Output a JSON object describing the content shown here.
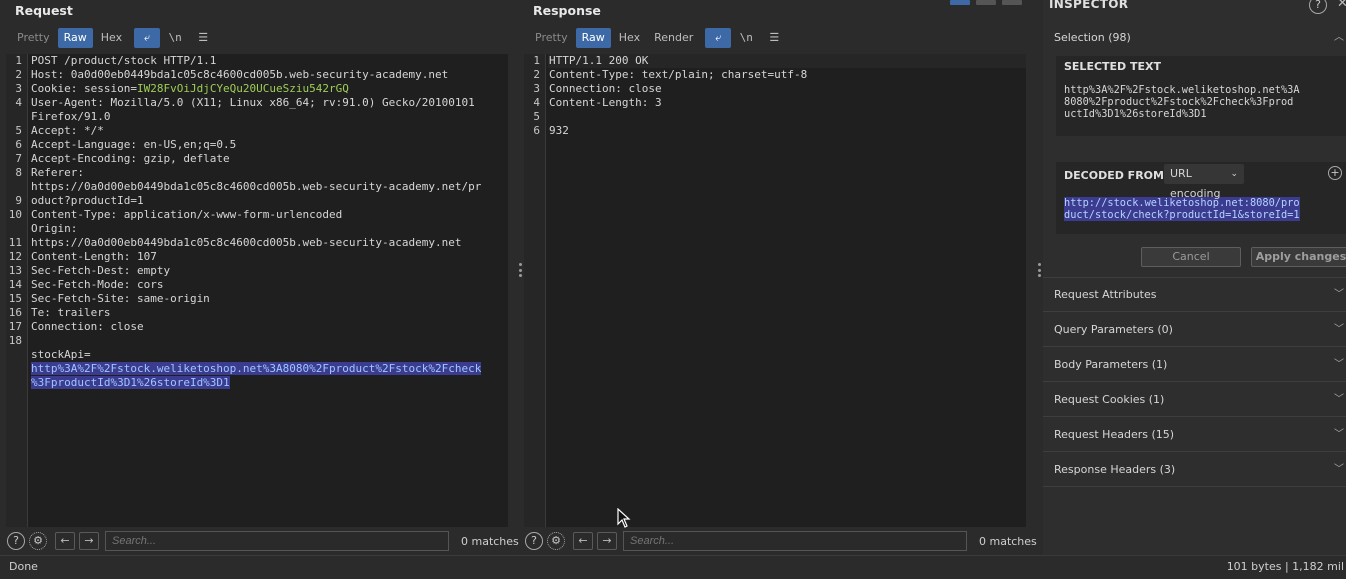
{
  "request": {
    "title": "Request",
    "tabs": [
      "Pretty",
      "Raw",
      "Hex"
    ],
    "active_tab": "Raw",
    "line_numbers": [
      "1",
      "2",
      "3",
      "4",
      "",
      "5",
      "6",
      "7",
      "8",
      "",
      "9",
      "10",
      "",
      "11",
      "12",
      "13",
      "14",
      "15",
      "16",
      "17",
      "18",
      "",
      ""
    ],
    "lines": {
      "l1": "POST /product/stock HTTP/1.1",
      "l2": "Host: 0a0d00eb0449bda1c05c8c4600cd005b.web-security-academy.net",
      "l3_key": "Cookie: session=",
      "l3_val": "IW28FvOiJdjCYeQu20UCueSziu542rGQ",
      "l4a": "User-Agent: Mozilla/5.0 (X11; Linux x86_64; rv:91.0) Gecko/20100101",
      "l4b": "Firefox/91.0",
      "l5": "Accept: */*",
      "l6": "Accept-Language: en-US,en;q=0.5",
      "l7": "Accept-Encoding: gzip, deflate",
      "l8a": "Referer:",
      "l8b": "https://0a0d00eb0449bda1c05c8c4600cd005b.web-security-academy.net/pr",
      "l8c": "oduct?productId=1",
      "l9": "Content-Type: application/x-www-form-urlencoded",
      "l10a": "Origin:",
      "l10b": "https://0a0d00eb0449bda1c05c8c4600cd005b.web-security-academy.net",
      "l11": "Content-Length: 107",
      "l12": "Sec-Fetch-Dest: empty",
      "l13": "Sec-Fetch-Mode: cors",
      "l14": "Sec-Fetch-Site: same-origin",
      "l15": "Te: trailers",
      "l16": "Connection: close",
      "l17": "",
      "l18a": "stockApi=",
      "l18b": "http%3A%2F%2Fstock.weliketoshop.net%3A8080%2Fproduct%2Fstock%2Fcheck",
      "l18c": "%3FproductId%3D1%26storeId%3D1"
    },
    "search_placeholder": "Search...",
    "matches": "0 matches"
  },
  "response": {
    "title": "Response",
    "tabs": [
      "Pretty",
      "Raw",
      "Hex",
      "Render"
    ],
    "active_tab": "Raw",
    "line_numbers": [
      "1",
      "2",
      "3",
      "4",
      "5",
      "6"
    ],
    "lines": {
      "l1": "HTTP/1.1 200 OK",
      "l2": "Content-Type: text/plain; charset=utf-8",
      "l3": "Connection: close",
      "l4": "Content-Length: 3",
      "l5": "",
      "l6": "932"
    },
    "search_placeholder": "Search...",
    "matches": "0 matches"
  },
  "toolbar_icons": {
    "wrap": "wrap-icon",
    "newline": "\\n",
    "menu": "menu-icon"
  },
  "inspector": {
    "title": "INSPECTOR",
    "selection_label": "Selection (98)",
    "selected_text_label": "SELECTED TEXT",
    "selected_text": "http%3A%2F%2Fstock.weliketoshop.net%3A\n8080%2Fproduct%2Fstock%2Fcheck%3Fprod\nuctId%3D1%26storeId%3D1",
    "decoded_from_label": "DECODED FROM:",
    "decoded_from_value": "URL encoding",
    "decoded_line1": "http://stock.weliketoshop.net:8080/pro",
    "decoded_line2": "duct/stock/check?productId=1&storeId=1",
    "cancel": "Cancel",
    "apply": "Apply changes",
    "sections": [
      "Request Attributes",
      "Query Parameters (0)",
      "Body Parameters (1)",
      "Request Cookies (1)",
      "Request Headers (15)",
      "Response Headers (3)"
    ]
  },
  "status": {
    "left": "Done",
    "right": "101 bytes | 1,182 mil"
  },
  "colors": {
    "accent": "#3d6aa6",
    "highlight": "#3b3b8f",
    "cookie_value": "#9fce57"
  }
}
